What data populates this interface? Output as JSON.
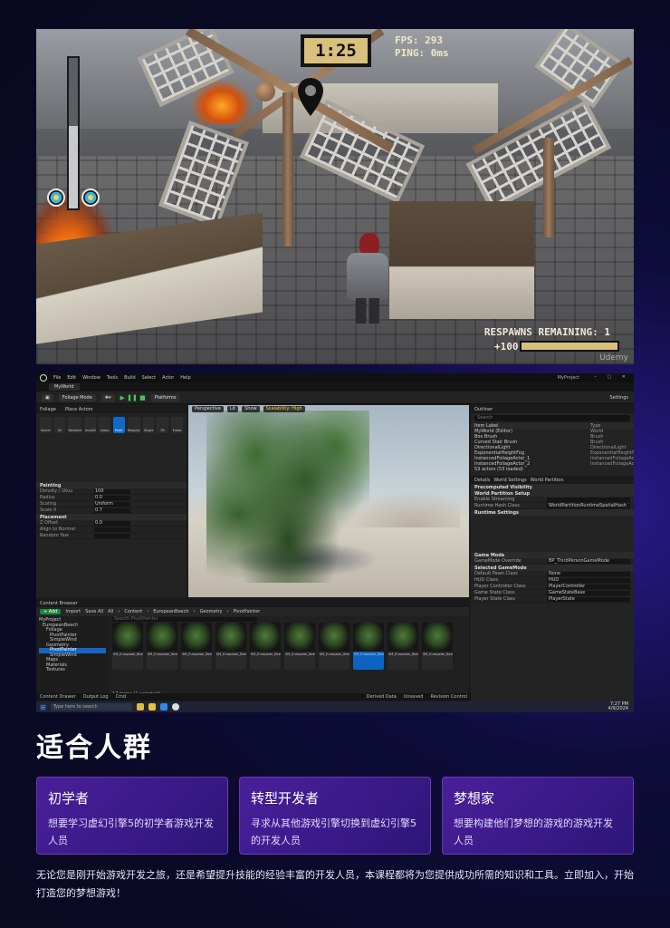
{
  "game": {
    "timer": "1:25",
    "fps_line1": "FPS: 293",
    "fps_line2": "PING: 0ms",
    "respawns": "RESPAWNS REMAINING: 1",
    "score": "+100",
    "health_level": 0.55,
    "progress_level": 1.0,
    "watermark": "Udemy",
    "icons": [
      "player-portrait-icon",
      "player-portrait-icon"
    ]
  },
  "editor": {
    "title_tab": "MyWorld",
    "project": "MyProject",
    "menu": [
      "File",
      "Edit",
      "Window",
      "Tools",
      "Build",
      "Select",
      "Actor",
      "Help"
    ],
    "toolbar": [
      "Foliage Mode",
      "Platforms"
    ],
    "settings_label": "Settings",
    "left_panel": {
      "tabs": [
        "Foliage",
        "Place Actors"
      ],
      "modes": [
        "Select",
        "All",
        "Deselect",
        "Invalid",
        "Lasso",
        "Paint",
        "Reapply",
        "Single",
        "Fill",
        "Erase"
      ],
      "sections": [
        "Painting",
        "Placement"
      ],
      "rows": [
        {
          "k": "Density / 1Kuu",
          "v": "100"
        },
        {
          "k": "Radius",
          "v": "0.0"
        },
        {
          "k": "Scaling",
          "v": "Uniform"
        },
        {
          "k": "Scale X",
          "v": "0.7"
        },
        {
          "k": "Z Offset",
          "v": "0.0"
        },
        {
          "k": "Align to Normal",
          "v": ""
        },
        {
          "k": "Random Yaw",
          "v": ""
        }
      ]
    },
    "viewport": {
      "buttons": [
        "Perspective",
        "Lit",
        "Show",
        "Scalability: High"
      ],
      "highlight": "Scalability: High"
    },
    "outliner": {
      "title": "Outliner",
      "search": "Search",
      "columns": [
        "Item Label",
        "Type"
      ],
      "rows": [
        {
          "label": "MyWorld (Editor)",
          "type": "World"
        },
        {
          "label": "Box Brush",
          "type": "Brush"
        },
        {
          "label": "Curved Stair Brush",
          "type": "Brush"
        },
        {
          "label": "DirectionalLight",
          "type": "DirectionalLight"
        },
        {
          "label": "ExponentialHeightFog",
          "type": "ExponentialHeightFog"
        },
        {
          "label": "InstancedFoliageActor_1",
          "type": "InstancedFoliageActor"
        },
        {
          "label": "InstancedFoliageActor_2",
          "type": "InstancedFoliageActor"
        }
      ],
      "actors_count": "53 actors (53 loaded)"
    },
    "details": {
      "tabs": [
        "Details",
        "World Settings",
        "World Partition"
      ],
      "sections": [
        "Precomputed Visibility",
        "World Partition Setup",
        "Runtime Settings",
        "Game Mode",
        "Selected GameMode"
      ],
      "rows": [
        {
          "k": "Enable Streaming",
          "v": ""
        },
        {
          "k": "Runtime Hash Class",
          "v": "WorldPartitionRuntimeSpatialHash"
        },
        {
          "k": "GameMode Override",
          "v": "BP_ThirdPersonGameMode"
        },
        {
          "k": "Default Pawn Class",
          "v": "None"
        },
        {
          "k": "HUD Class",
          "v": "HUD"
        },
        {
          "k": "Player Controller Class",
          "v": "PlayerController"
        },
        {
          "k": "Game State Class",
          "v": "GameStateBase"
        },
        {
          "k": "Player State Class",
          "v": "PlayerState"
        }
      ]
    },
    "content_browser": {
      "title": "Content Browser",
      "add": "+ Add",
      "import": "Import",
      "save_all": "Save All",
      "path": [
        "All",
        "Content",
        "EuropeanBeech",
        "Geometry",
        "PivotPainter"
      ],
      "filter": "Search PivotPainter",
      "folders": [
        "MyProject",
        "EuropeanBeech",
        "Foliage",
        "PivotPainter",
        "SimpleWind",
        "Geometry",
        "PivotPainter",
        "SimpleWind",
        "Maps",
        "Materials",
        "Textures"
      ],
      "selected_folder": "PivotPainter",
      "assets": [
        "SM_European_Beech_Field_01",
        "SM_European_Beech_Forest_01",
        "SM_European_Beech_Forest_02",
        "SM_European_Beech_Forest_03",
        "SM_European_Beech_Forest_04",
        "SM_European_Beech_Forest_05",
        "SM_European_Beech_Forest_06",
        "SM_European_Beech_Forest_07",
        "SM_European_Beech_Forest_08",
        "SM_European_Beech_Sapling_01"
      ],
      "selected_asset": 7,
      "count": "17 items (1 selected)"
    },
    "status": [
      "Content Drawer",
      "Output Log",
      "Cmd"
    ],
    "status_right": [
      "Derived Data",
      "Unsaved",
      "Revision Control"
    ],
    "taskbar": {
      "search": "Type here to search",
      "time": "7:27 PM",
      "date": "4/9/2024"
    }
  },
  "section": {
    "title": "适合人群",
    "cards": [
      {
        "title": "初学者",
        "desc": "想要学习虚幻引擎5的初学者游戏开发人员"
      },
      {
        "title": "转型开发者",
        "desc": "寻求从其他游戏引擎切换到虚幻引擎5的开发人员"
      },
      {
        "title": "梦想家",
        "desc": "想要构建他们梦想的游戏的游戏开发人员"
      }
    ],
    "description": "无论您是刚开始游戏开发之旅，还是希望提升技能的经验丰富的开发人员，本课程都将为您提供成功所需的知识和工具。立即加入，开始打造您的梦想游戏！"
  }
}
